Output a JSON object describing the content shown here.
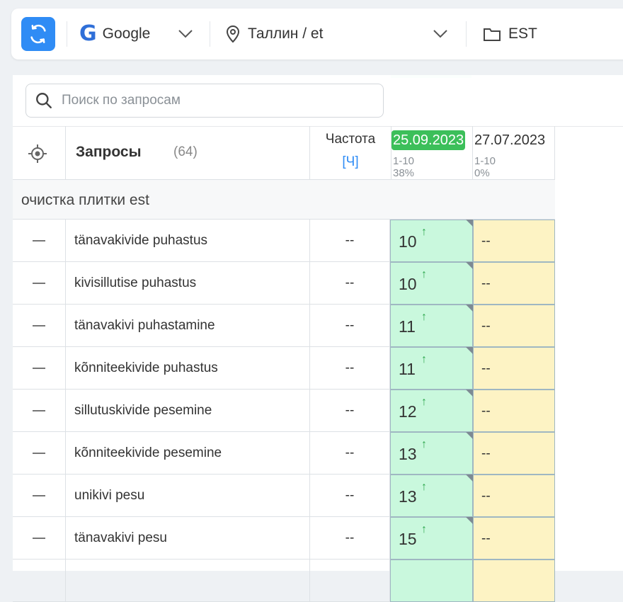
{
  "toolbar": {
    "engine": "Google",
    "region": "Таллин / et",
    "project": "EST"
  },
  "search": {
    "placeholder": "Поиск по запросам"
  },
  "table": {
    "header": {
      "queries_title": "Запросы",
      "queries_count": "(64)",
      "frequency_title": "Частота",
      "frequency_sub": "[Ч]",
      "dates": [
        {
          "date": "25.09.2023",
          "range": "1-10",
          "pct": "38%",
          "active": true
        },
        {
          "date": "27.07.2023",
          "range": "1-10",
          "pct": "0%",
          "active": false
        }
      ]
    },
    "group": "очистка плитки est",
    "rows": [
      {
        "keyword": "tänavakivide puhastus",
        "freq": "--",
        "pos": "10",
        "prev": "--"
      },
      {
        "keyword": "kivisillutise puhastus",
        "freq": "--",
        "pos": "10",
        "prev": "--"
      },
      {
        "keyword": "tänavakivi puhastamine",
        "freq": "--",
        "pos": "11",
        "prev": "--"
      },
      {
        "keyword": "kõnniteekivide puhastus",
        "freq": "--",
        "pos": "11",
        "prev": "--"
      },
      {
        "keyword": "sillutuskivide pesemine",
        "freq": "--",
        "pos": "12",
        "prev": "--"
      },
      {
        "keyword": "kõnniteekivide pesemine",
        "freq": "--",
        "pos": "13",
        "prev": "--"
      },
      {
        "keyword": "unikivi pesu",
        "freq": "--",
        "pos": "13",
        "prev": "--"
      },
      {
        "keyword": "tänavakivi pesu",
        "freq": "--",
        "pos": "15",
        "prev": "--"
      }
    ]
  },
  "colors": {
    "accent": "#2f8cf5",
    "active_date": "#3cbf5a",
    "position_bg": "#c9f8dd",
    "empty_bg": "#fdf3c4",
    "up_arrow": "#2fa84f"
  },
  "icons": {
    "refresh": "refresh-icon",
    "engine": "google-g-icon",
    "region": "location-pin-icon",
    "project": "folder-icon",
    "search": "search-icon",
    "target": "crosshair-icon"
  }
}
